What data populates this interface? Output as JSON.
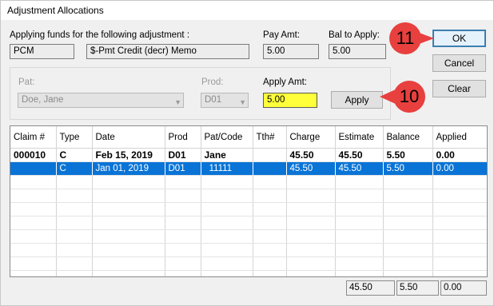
{
  "window": {
    "title": "Adjustment Allocations"
  },
  "header": {
    "applying_label": "Applying funds for the following adjustment :",
    "adjustment_code": "PCM",
    "adjustment_desc": "$-Pmt Credit (decr) Memo",
    "pay_amt_label": "Pay Amt:",
    "pay_amt_value": "5.00",
    "bal_label": "Bal to Apply:",
    "bal_value": "5.00"
  },
  "apply_group": {
    "pat_label": "Pat:",
    "pat_value": "Doe, Jane",
    "prod_label": "Prod:",
    "prod_value": "D01",
    "apply_amt_label": "Apply Amt:",
    "apply_amt_value": "5.00",
    "apply_button": "Apply"
  },
  "buttons": {
    "ok": "OK",
    "cancel": "Cancel",
    "clear": "Clear"
  },
  "callouts": {
    "ok_step": "11",
    "apply_step": "10"
  },
  "table": {
    "columns": [
      "Claim #",
      "Type",
      "Date",
      "Prod",
      "Pat/Code",
      "Tth#",
      "Charge",
      "Estimate",
      "Balance",
      "Applied"
    ],
    "rows": [
      [
        "000010",
        "C",
        "Feb 15, 2019",
        "D01",
        "Jane",
        "",
        "45.50",
        "45.50",
        "5.50",
        "0.00"
      ],
      [
        "",
        "C",
        "Jan 01, 2019",
        "D01",
        "11111",
        "",
        "45.50",
        "45.50",
        "5.50",
        "0.00"
      ]
    ]
  },
  "totals": {
    "estimate": "45.50",
    "balance": "5.50",
    "applied": "0.00"
  },
  "colors": {
    "callout": "#e8403e",
    "highlight": "#ffff3a",
    "selection": "#0a74d6"
  }
}
